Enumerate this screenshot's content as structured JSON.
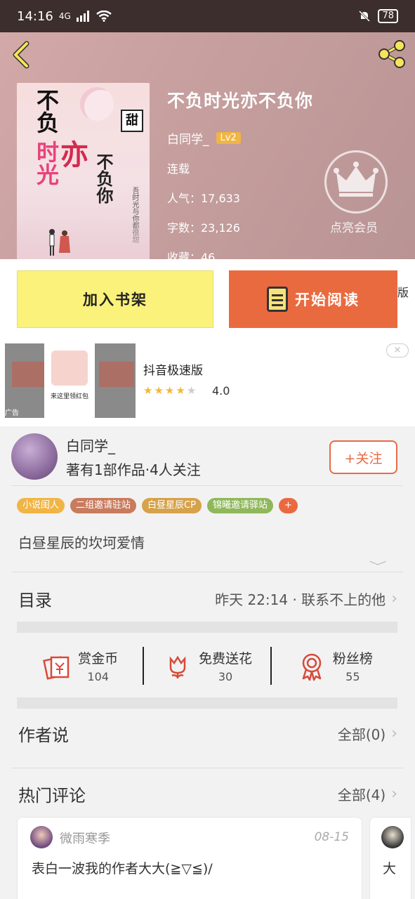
{
  "status": {
    "time": "14:16",
    "network": "4G",
    "battery": "78"
  },
  "book": {
    "title": "不负时光亦不负你",
    "author": "白同学_",
    "level": "Lv2",
    "status": "连载",
    "popularity": "人气：17,633",
    "word_count": "字数：23,126",
    "favorites": "收藏：46",
    "vip_label": "点亮会员",
    "cover": {
      "line1": "不负",
      "line2": "时光",
      "line3": "亦",
      "line4": "不负你",
      "tag": "甜",
      "small": "吾时光与你都很甜"
    }
  },
  "actions": {
    "add_shelf": "加入书架",
    "start_read": "开始阅读",
    "edge_text": "版"
  },
  "ad": {
    "title": "抖音极速版",
    "rating": "4.0",
    "stars": 4,
    "label": "广告",
    "close": "×",
    "thumb_text": "来这里领红包"
  },
  "author_section": {
    "name": "白同学_",
    "stats": "著有1部作品·4人关注",
    "follow": "+关注",
    "tags": [
      {
        "label": "小说闺人",
        "color": "#f0b544"
      },
      {
        "label": "二组邀请驻站",
        "color": "#c97b5e"
      },
      {
        "label": "白昼星辰CP",
        "color": "#d6a24a"
      },
      {
        "label": "锦曦邀请驿站",
        "color": "#8fb85a"
      },
      {
        "label": "+",
        "color": "#ea6a3f"
      }
    ],
    "description": "白昼星辰的坎坷爱情"
  },
  "catalog": {
    "title": "目录",
    "latest": "昨天 22:14 · 联系不上的他"
  },
  "rewards": [
    {
      "label": "赏金币",
      "value": "104",
      "icon": "coin-icon"
    },
    {
      "label": "免费送花",
      "value": "30",
      "icon": "flower-icon"
    },
    {
      "label": "粉丝榜",
      "value": "55",
      "icon": "medal-icon"
    }
  ],
  "author_says": {
    "title": "作者说",
    "link": "全部(0)"
  },
  "hot_comments": {
    "title": "热门评论",
    "link": "全部(4)",
    "items": [
      {
        "user": "微雨寒季",
        "date": "08-15",
        "text": "表白一波我的作者大大(≧▽≦)/"
      }
    ],
    "peek_text": "大"
  },
  "colors": {
    "accent": "#ea6a3f",
    "shelf": "#fbf27b",
    "hero": "#c79f9f"
  }
}
